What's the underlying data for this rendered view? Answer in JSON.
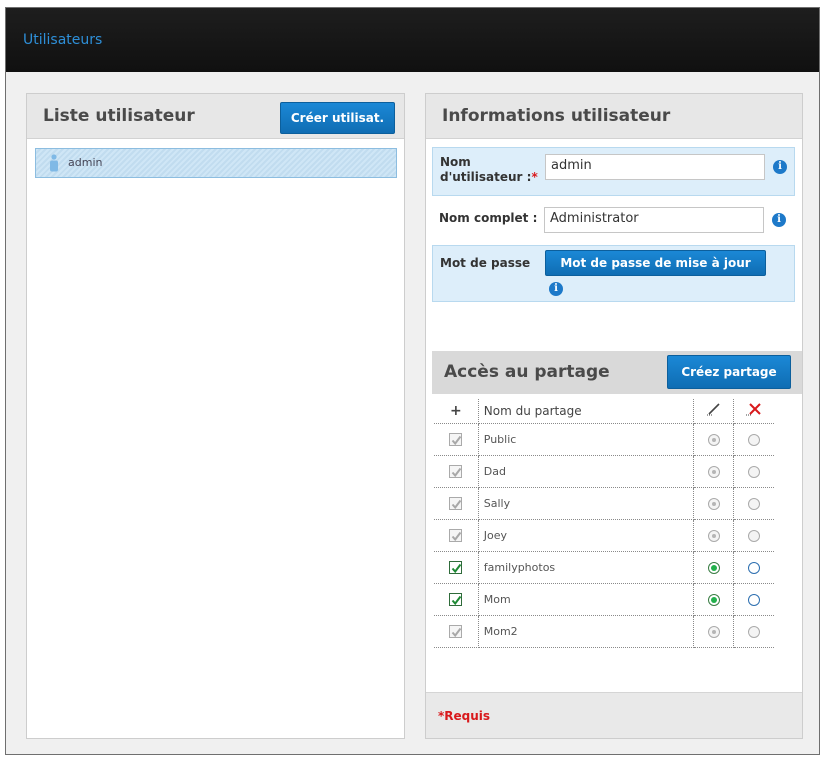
{
  "header": {
    "title": "Utilisateurs"
  },
  "user_list": {
    "title": "Liste utilisateur",
    "create_button": "Créer utilisat.",
    "users": [
      {
        "name": "admin"
      }
    ]
  },
  "user_info": {
    "title": "Informations utilisateur",
    "username_label_line1": "Nom",
    "username_label_line2": "d'utilisateur :",
    "required_marker": "*",
    "username_value": "admin",
    "fullname_label": "Nom complet :",
    "fullname_value": "Administrator",
    "password_label": "Mot de passe",
    "password_button": "Mot de passe de mise à jour"
  },
  "share_access": {
    "title": "Accès au partage",
    "create_button": "Créez partage",
    "columns": {
      "add": "+",
      "name": "Nom du partage",
      "read_write_icon": "pencil-icon",
      "no_access_icon": "red-x-icon"
    },
    "shares": [
      {
        "name": "Public",
        "checked": true,
        "enabled": false,
        "access": "rw"
      },
      {
        "name": "Dad",
        "checked": true,
        "enabled": false,
        "access": "rw"
      },
      {
        "name": "Sally",
        "checked": true,
        "enabled": false,
        "access": "rw"
      },
      {
        "name": "Joey",
        "checked": true,
        "enabled": false,
        "access": "rw"
      },
      {
        "name": "familyphotos",
        "checked": true,
        "enabled": true,
        "access": "rw"
      },
      {
        "name": "Mom",
        "checked": true,
        "enabled": true,
        "access": "rw"
      },
      {
        "name": "Mom2",
        "checked": true,
        "enabled": false,
        "access": "rw"
      }
    ]
  },
  "footer": {
    "required_note": "*Requis"
  },
  "colors": {
    "accent": "#1b88d6",
    "header_bg": "#141414",
    "required": "#d9191c"
  }
}
